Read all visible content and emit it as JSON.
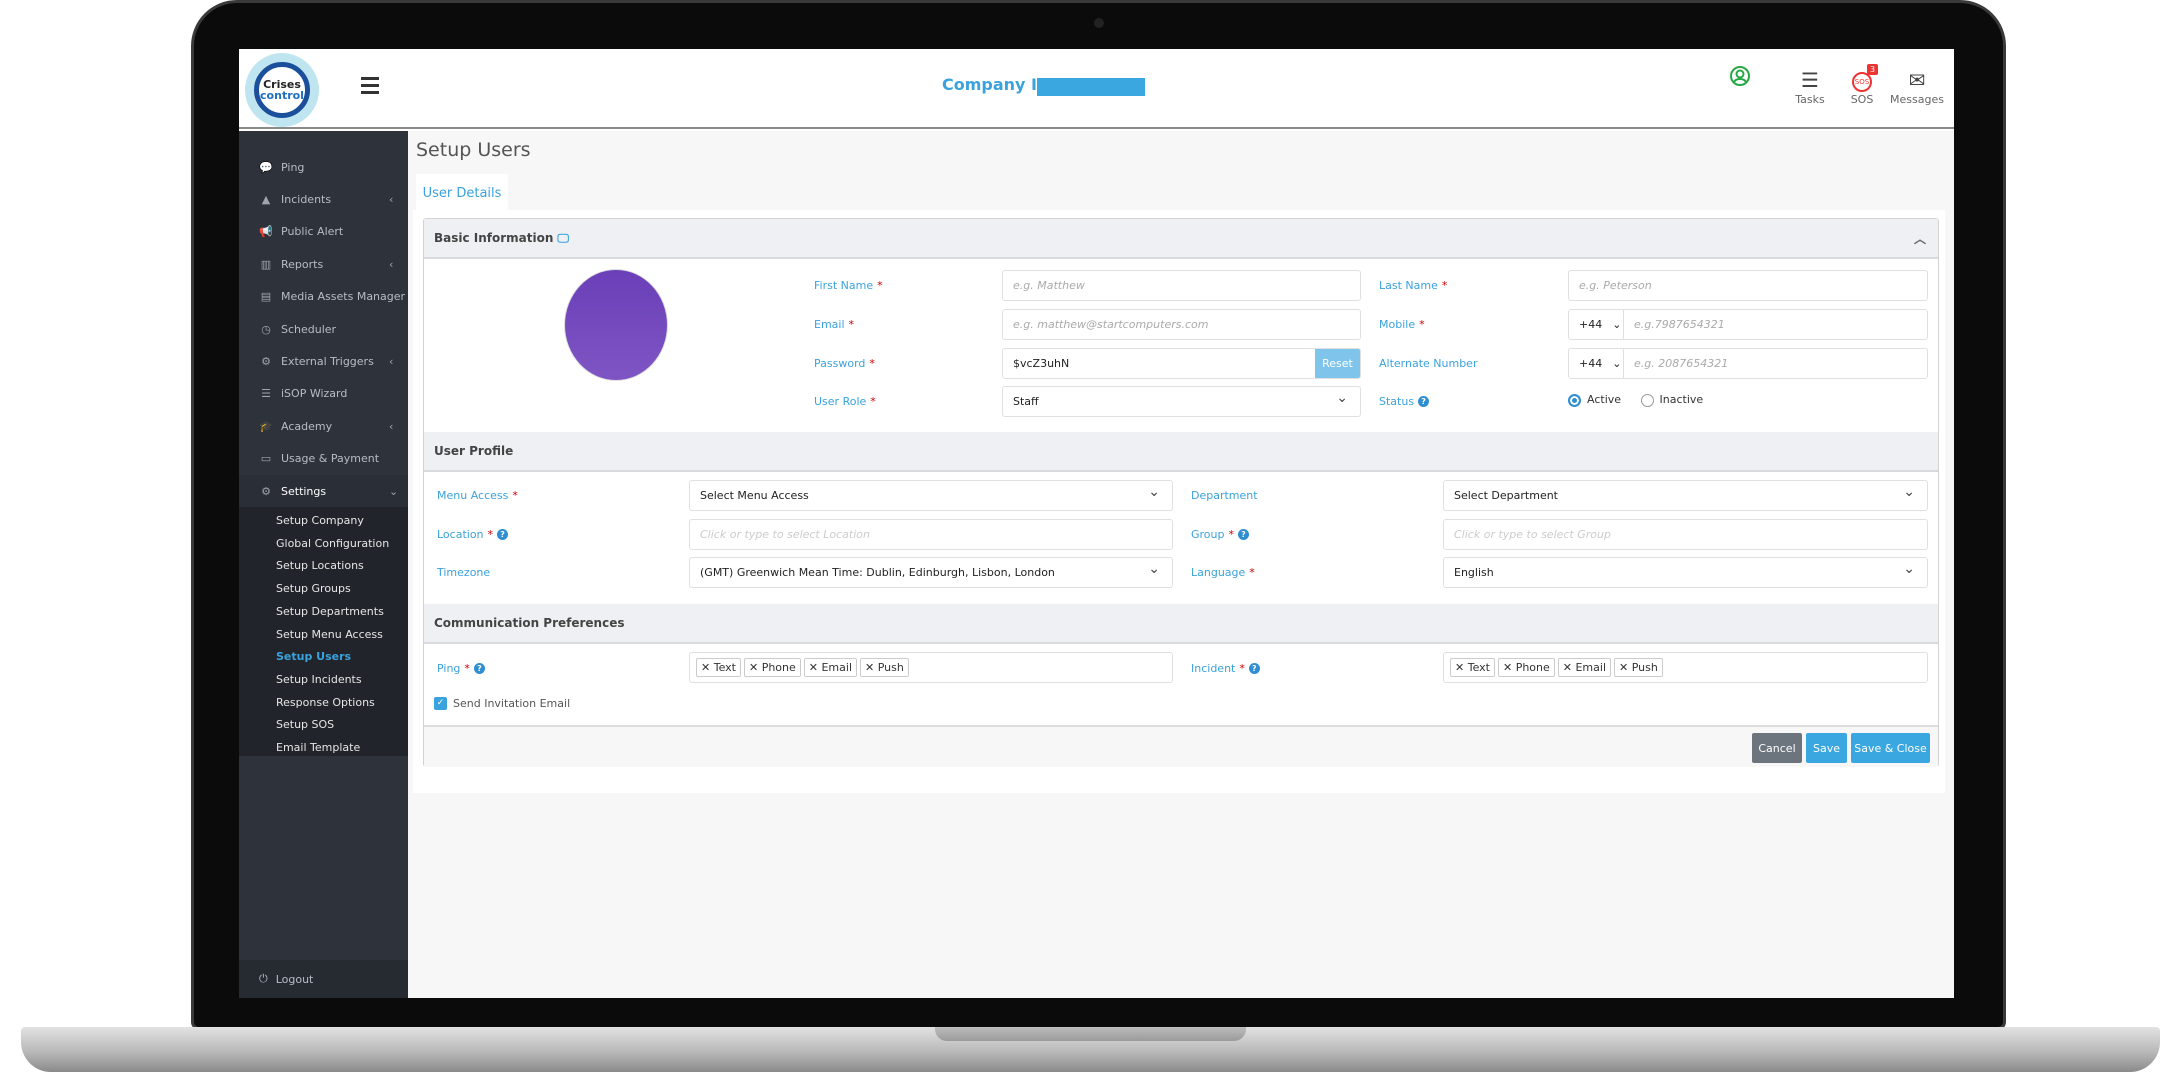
{
  "header": {
    "company_label": "Company Id:",
    "tasks": "Tasks",
    "sos": "SOS",
    "sos_badge": "3",
    "messages": "Messages",
    "sos_icon_text": "SOS"
  },
  "logo": {
    "line1": "Crises",
    "line2": "control"
  },
  "sidebar": {
    "items": [
      {
        "label": "Ping",
        "icon": "comments-icon",
        "glyph": "💬",
        "chevron": false
      },
      {
        "label": "Incidents",
        "icon": "warning-icon",
        "glyph": "▲",
        "chevron": true
      },
      {
        "label": "Public Alert",
        "icon": "megaphone-icon",
        "glyph": "📢",
        "chevron": false
      },
      {
        "label": "Reports",
        "icon": "bar-chart-icon",
        "glyph": "▥",
        "chevron": true
      },
      {
        "label": "Media Assets Manager",
        "icon": "film-icon",
        "glyph": "▤",
        "chevron": false
      },
      {
        "label": "Scheduler",
        "icon": "clock-icon",
        "glyph": "◷",
        "chevron": false
      },
      {
        "label": "External Triggers",
        "icon": "cogs-icon",
        "glyph": "⚙",
        "chevron": true
      },
      {
        "label": "iSOP Wizard",
        "icon": "list-icon",
        "glyph": "☰",
        "chevron": false
      },
      {
        "label": "Academy",
        "icon": "graduation-cap-icon",
        "glyph": "🎓",
        "chevron": true
      },
      {
        "label": "Usage & Payment",
        "icon": "credit-card-icon",
        "glyph": "▭",
        "chevron": false
      },
      {
        "label": "Settings",
        "icon": "gear-icon",
        "glyph": "⚙",
        "chevron": true
      }
    ],
    "settings_sub": [
      "Setup Company",
      "Global Configuration",
      "Setup Locations",
      "Setup Groups",
      "Setup Departments",
      "Setup Menu Access",
      "Setup Users",
      "Setup Incidents",
      "Response Options",
      "Setup SOS",
      "Email Template"
    ],
    "active_sub": "Setup Users",
    "logout": "Logout"
  },
  "main": {
    "title": "Setup Users",
    "tab": "User Details",
    "basic": {
      "heading": "Basic Information",
      "first_name": {
        "label": "First Name",
        "placeholder": "e.g. Matthew"
      },
      "last_name": {
        "label": "Last Name",
        "placeholder": "e.g. Peterson"
      },
      "email": {
        "label": "Email",
        "placeholder": "e.g. matthew@startcomputers.com"
      },
      "mobile": {
        "label": "Mobile",
        "code": "+44",
        "placeholder": "e.g.7987654321"
      },
      "password": {
        "label": "Password",
        "value": "$vcZ3uhN",
        "reset": "Reset"
      },
      "alternate": {
        "label": "Alternate Number",
        "code": "+44",
        "placeholder": "e.g. 2087654321"
      },
      "user_role": {
        "label": "User Role",
        "value": "Staff"
      },
      "status": {
        "label": "Status",
        "options": [
          "Active",
          "Inactive"
        ],
        "selected": "Active"
      },
      "avatar_color": "#6f42c1"
    },
    "profile": {
      "heading": "User Profile",
      "menu_access": {
        "label": "Menu Access",
        "value": "Select Menu Access"
      },
      "department": {
        "label": "Department",
        "value": "Select Department"
      },
      "location": {
        "label": "Location",
        "placeholder": "Click or type to select Location"
      },
      "group": {
        "label": "Group",
        "placeholder": "Click or type to select Group"
      },
      "timezone": {
        "label": "Timezone",
        "value": "(GMT) Greenwich Mean Time: Dublin, Edinburgh, Lisbon, London"
      },
      "language": {
        "label": "Language",
        "value": "English"
      }
    },
    "comm": {
      "heading": "Communication Preferences",
      "ping": {
        "label": "Ping",
        "chips": [
          "Text",
          "Phone",
          "Email",
          "Push"
        ]
      },
      "incident": {
        "label": "Incident",
        "chips": [
          "Text",
          "Phone",
          "Email",
          "Push"
        ]
      },
      "send_invite": {
        "label": "Send Invitation Email",
        "checked": true
      }
    },
    "buttons": {
      "cancel": "Cancel",
      "save": "Save",
      "save_close": "Save & Close"
    }
  },
  "colors": {
    "accent": "#3aa2dc",
    "sidebar": "#2d323b",
    "cancel": "#6c757d",
    "required": "#cc0000"
  }
}
